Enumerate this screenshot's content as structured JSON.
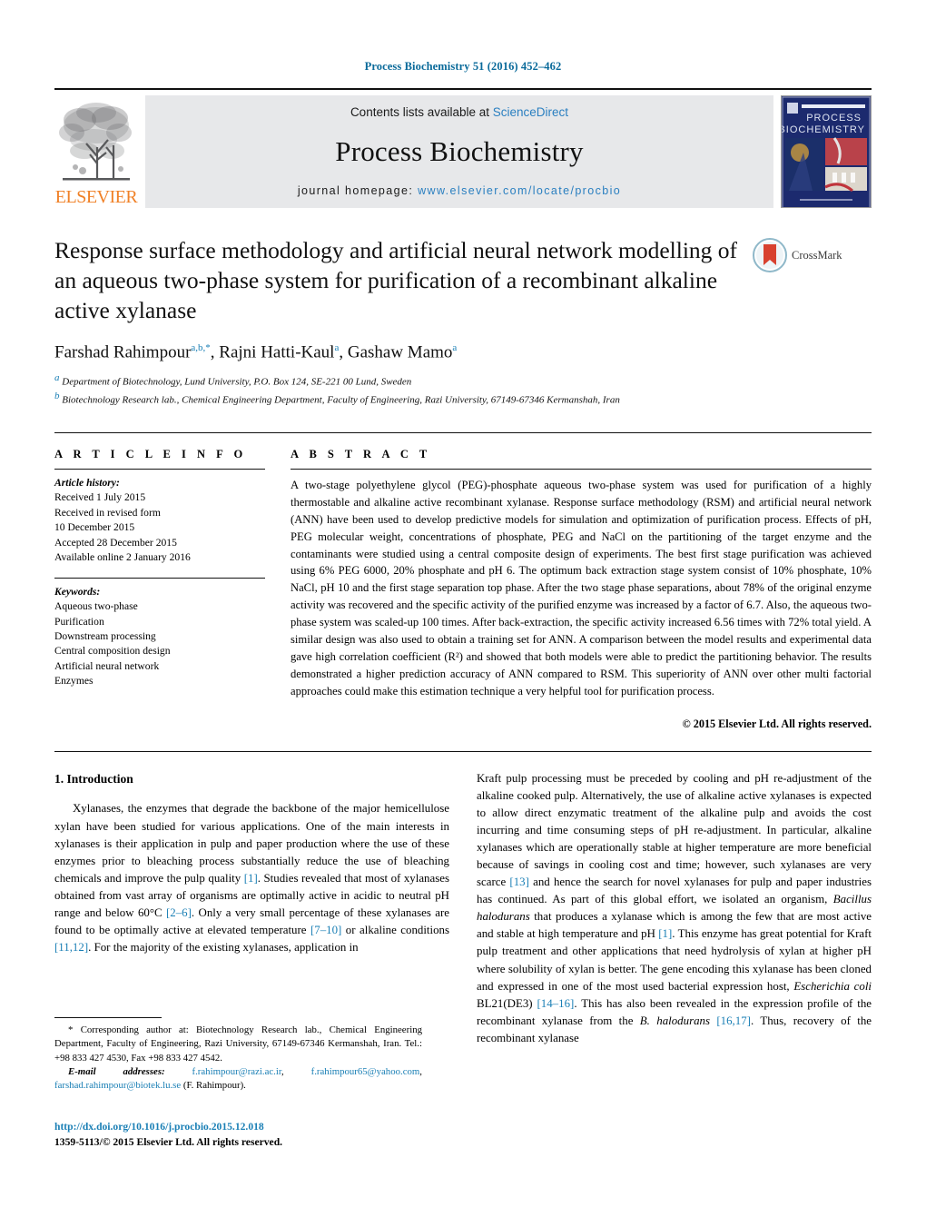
{
  "running_head": "Process Biochemistry 51 (2016) 452–462",
  "masthead": {
    "publisher_name": "ELSEVIER",
    "contents_prefix": "Contents lists available at ",
    "contents_link": "ScienceDirect",
    "journal_name": "Process Biochemistry",
    "homepage_prefix": "journal homepage: ",
    "homepage_url": "www.elsevier.com/locate/procbio",
    "cover_title_line1": "PROCESS",
    "cover_title_line2": "BIOCHEMISTRY"
  },
  "article": {
    "title": "Response surface methodology and artificial neural network modelling of an aqueous two-phase system for purification of a recombinant alkaline active xylanase",
    "crossmark_label": "CrossMark",
    "authors": [
      {
        "name": "Farshad Rahimpour",
        "marks": "a,b,*"
      },
      {
        "name": "Rajni Hatti-Kaul",
        "marks": "a"
      },
      {
        "name": "Gashaw Mamo",
        "marks": "a"
      }
    ],
    "affiliations": [
      {
        "mark": "a",
        "text": "Department of Biotechnology, Lund University, P.O. Box 124, SE-221 00 Lund, Sweden"
      },
      {
        "mark": "b",
        "text": "Biotechnology Research lab., Chemical Engineering Department, Faculty of Engineering, Razi University, 67149-67346 Kermanshah, Iran"
      }
    ]
  },
  "article_info": {
    "heading": "A R T I C L E   I N F O",
    "history_label": "Article history:",
    "history": [
      "Received 1 July 2015",
      "Received in revised form",
      "10 December 2015",
      "Accepted 28 December 2015",
      "Available online 2 January 2016"
    ],
    "keywords_label": "Keywords:",
    "keywords": [
      "Aqueous two-phase",
      "Purification",
      "Downstream processing",
      "Central composition design",
      "Artificial neural network",
      "Enzymes"
    ]
  },
  "abstract": {
    "heading": "A B S T R A C T",
    "text": "A two-stage polyethylene glycol (PEG)-phosphate aqueous two-phase system was used for purification of a highly thermostable and alkaline active recombinant xylanase. Response surface methodology (RSM) and artificial neural network (ANN) have been used to develop predictive models for simulation and optimization of purification process. Effects of pH, PEG molecular weight, concentrations of phosphate, PEG and NaCl on the partitioning of the target enzyme and the contaminants were studied using a central composite design of experiments. The best first stage purification was achieved using 6% PEG 6000, 20% phosphate and pH 6. The optimum back extraction stage system consist of 10% phosphate, 10% NaCl, pH 10 and the first stage separation top phase. After the two stage phase separations, about 78% of the original enzyme activity was recovered and the specific activity of the purified enzyme was increased by a factor of 6.7. Also, the aqueous two-phase system was scaled-up 100 times. After back-extraction, the specific activity increased 6.56 times with 72% total yield. A similar design was also used to obtain a training set for ANN. A comparison between the model results and experimental data gave high correlation coefficient (R²) and showed that both models were able to predict the partitioning behavior. The results demonstrated a higher prediction accuracy of ANN compared to RSM. This superiority of ANN over other multi factorial approaches could make this estimation technique a very helpful tool for purification process.",
    "copyright": "© 2015 Elsevier Ltd. All rights reserved."
  },
  "body": {
    "section_heading": "1.  Introduction",
    "left_paragraph_part1": "Xylanases, the enzymes that degrade the backbone of the major hemicellulose xylan have been studied for various applications. One of the main interests in xylanases is their application in pulp and paper production where the use of these enzymes prior to bleaching process substantially reduce the use of bleaching chemicals and improve the pulp quality ",
    "left_ref1": "[1]",
    "left_paragraph_part2": ". Studies revealed that most of xylanases obtained from vast array of organisms are optimally active in acidic to neutral pH range and below 60°C ",
    "left_ref2": "[2–6]",
    "left_paragraph_part3": ". Only a very small percentage of these xylanases are found to be optimally active at elevated temperature ",
    "left_ref3": "[7–10]",
    "left_paragraph_part4": " or alkaline conditions ",
    "left_ref4": "[11,12]",
    "left_paragraph_part5": ". For the majority of the existing xylanases, application in",
    "right_part1": "Kraft pulp processing must be preceded by cooling and pH re-adjustment of the alkaline cooked pulp. Alternatively, the use of alkaline active xylanases is expected to allow direct enzymatic treatment of the alkaline pulp and avoids the cost incurring and time consuming steps of pH re-adjustment. In particular, alkaline xylanases which are operationally stable at higher temperature are more beneficial because of savings in cooling cost and time; however, such xylanases are very scarce ",
    "right_ref1": "[13]",
    "right_part2": " and hence the search for novel xylanases for pulp and paper industries has continued. As part of this global effort, we isolated an organism, ",
    "right_ital1": "Bacillus halodurans",
    "right_part3": " that produces a xylanase which is among the few that are most active and stable at high temperature and pH ",
    "right_ref2": "[1]",
    "right_part4": ". This enzyme has great potential for Kraft pulp treatment and other applications that need hydrolysis of xylan at higher pH where solubility of xylan is better. The gene encoding this xylanase has been cloned and expressed in one of the most used bacterial expression host, ",
    "right_ital2": "Escherichia coli",
    "right_part5": " BL21(DE3) ",
    "right_ref3": "[14–16]",
    "right_part6": ". This has also been revealed in the expression profile of the recombinant xylanase from the ",
    "right_ital3": "B. halodurans",
    "right_part7": " ",
    "right_ref4": "[16,17]",
    "right_part8": ". Thus, recovery of the recombinant xylanase"
  },
  "footnote": {
    "star": "*",
    "corresponding_text": "Corresponding author at: Biotechnology Research lab., Chemical Engineering Department, Faculty of Engineering, Razi University, 67149-67346 Kermanshah, Iran. Tel.: +98 833 427 4530, Fax +98 833 427 4542.",
    "email_label": "E-mail addresses:",
    "emails": [
      "f.rahimpour@razi.ac.ir",
      "f.rahimpour65@yahoo.com",
      "farshad.rahimpour@biotek.lu.se"
    ],
    "email_suffix": "(F. Rahimpour)."
  },
  "doi_block": {
    "doi": "http://dx.doi.org/10.1016/j.procbio.2015.12.018",
    "issn_line": "1359-5113/© 2015 Elsevier Ltd. All rights reserved."
  },
  "colors": {
    "link_blue": "#1a7fb5",
    "sciencedirect_blue": "#2a7fc0",
    "elsevier_orange": "#f08127",
    "band_gray": "#e7e8ea",
    "cover_navy": "#1c2a6e"
  }
}
